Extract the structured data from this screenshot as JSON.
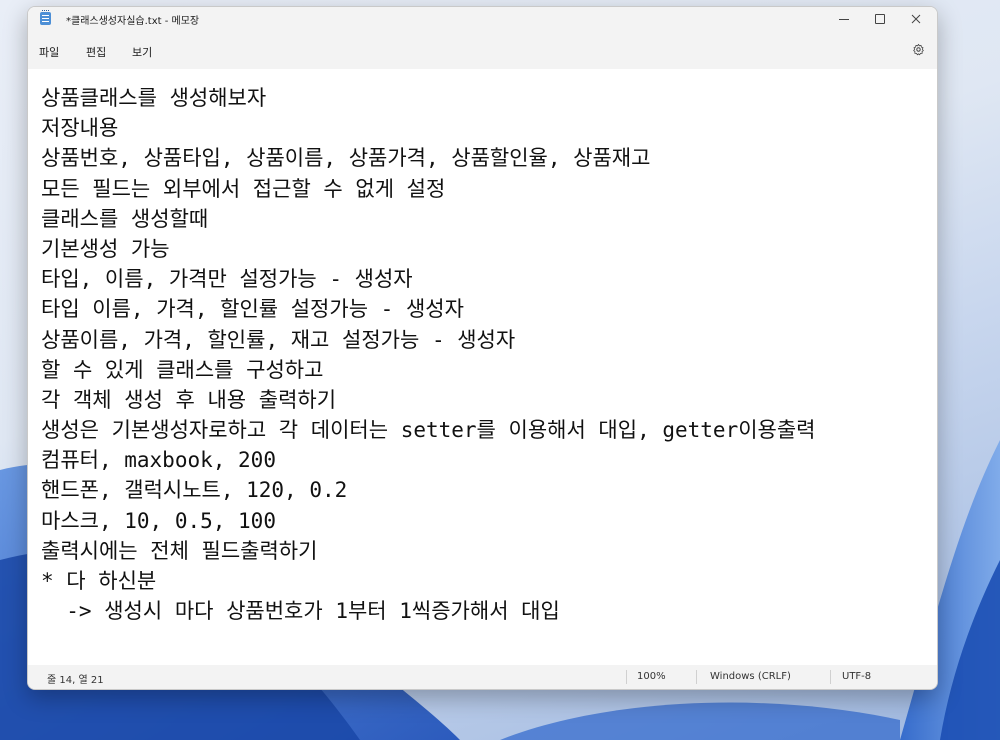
{
  "window": {
    "title": "*클래스생성자실습.txt - 메모장"
  },
  "menu": {
    "file": "파일",
    "edit": "편집",
    "view": "보기"
  },
  "editor": {
    "lines": [
      "상품클래스를 생성해보자",
      "저장내용",
      "상품번호, 상품타입, 상품이름, 상품가격, 상품할인율, 상품재고",
      "모든 필드는 외부에서 접근할 수 없게 설정",
      "클래스를 생성할때",
      "기본생성 가능",
      "타입, 이름, 가격만 설정가능 - 생성자",
      "타입 이름, 가격, 할인률 설정가능 - 생성자",
      "상품이름, 가격, 할인률, 재고 설정가능 - 생성자",
      "할 수 있게 클래스를 구성하고",
      "각 객체 생성 후 내용 출력하기",
      "생성은 기본생성자로하고 각 데이터는 setter를 이용해서 대입, getter이용출력",
      "컴퓨터, maxbook, 200",
      "핸드폰, 갤럭시노트, 120, 0.2",
      "마스크, 10, 0.5, 100",
      "출력시에는 전체 필드출력하기",
      "* 다 하신분",
      "  -> 생성시 마다 상품번호가 1부터 1씩증가해서 대입"
    ]
  },
  "status": {
    "position": "줄 14, 열 21",
    "zoom": "100%",
    "line_ending": "Windows (CRLF)",
    "encoding": "UTF-8"
  },
  "icons": {
    "app": "notepad-icon",
    "settings": "gear-icon",
    "minimize": "minimize-icon",
    "maximize": "maximize-icon",
    "close": "close-icon"
  },
  "colors": {
    "accent": "#4d8fd6",
    "chrome": "#f3f3f3"
  }
}
